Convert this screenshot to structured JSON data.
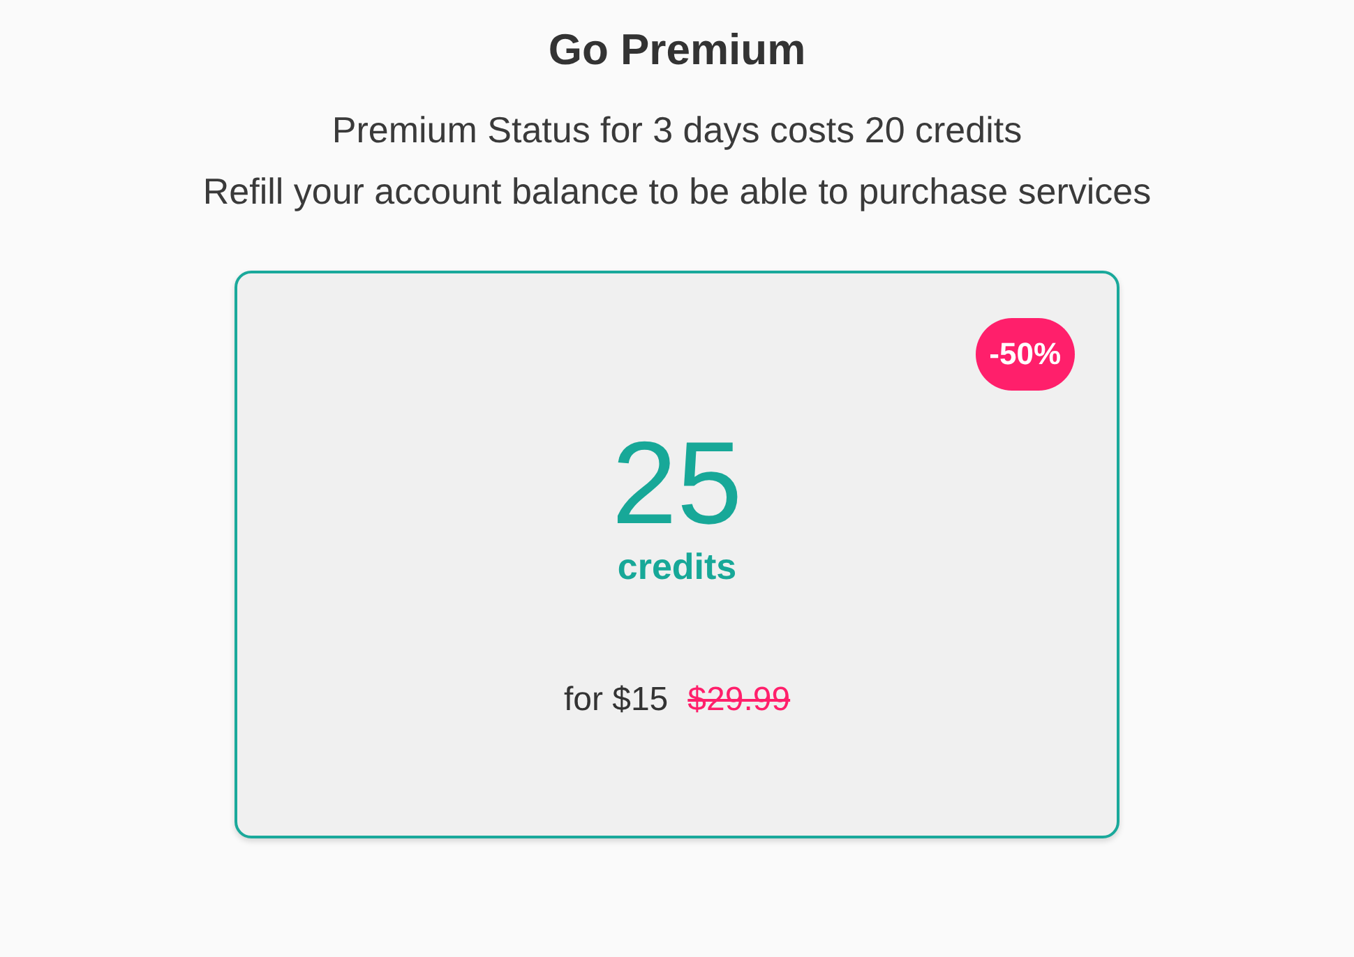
{
  "title": "Go Premium",
  "subtitle_lines": [
    "Premium Status for 3 days costs 20 credits",
    "Refill your account balance to be able to purchase services"
  ],
  "offer": {
    "badge": "-50%",
    "amount": "25",
    "unit": "credits",
    "price": "for $15",
    "old_price": "$29.99"
  }
}
